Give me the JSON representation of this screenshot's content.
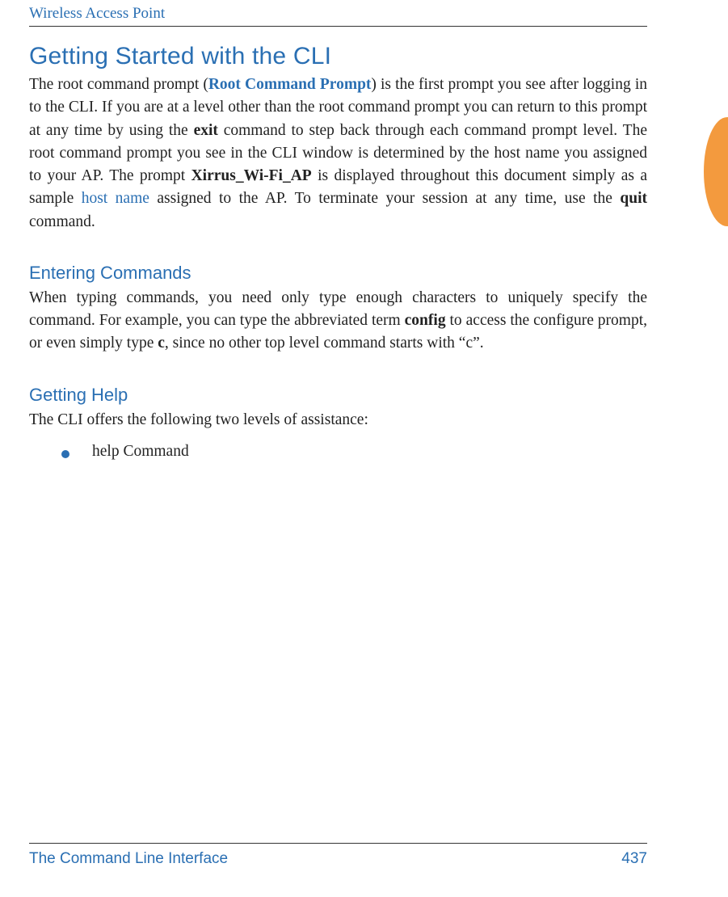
{
  "header": {
    "running_title": "Wireless Access Point"
  },
  "section1": {
    "title": "Getting Started with the CLI",
    "p1_a": "The root command prompt (",
    "p1_link": "Root Command Prompt",
    "p1_b": ") is the first prompt you see after logging in to the CLI. If you are at a level other than the root command prompt you can return to this prompt at any time by using the ",
    "p1_bold1": "exit",
    "p1_c": " command to step back through each command prompt level. The root command prompt you see in the CLI window is determined by the host name you assigned to your AP. The prompt ",
    "p1_bold2": "Xirrus_Wi-Fi_AP",
    "p1_d": " is displayed throughout this document simply as a sample ",
    "p1_link2": "host name",
    "p1_e": " assigned to the AP. To terminate your session at any time, use the ",
    "p1_bold3": "quit",
    "p1_f": " command."
  },
  "section2": {
    "title": "Entering Commands",
    "p1_a": "When typing commands, you need only type enough characters to uniquely specify the command. For example, you can type the abbreviated term ",
    "p1_bold1": "config",
    "p1_b": " to access the configure prompt, or even simply type ",
    "p1_bold2": "c",
    "p1_c": ", since no other top level command starts with “c”."
  },
  "section3": {
    "title": "Getting Help",
    "p1": "The CLI offers the following two levels of assistance:",
    "bullet1": "help Command"
  },
  "footer": {
    "left": "The Command Line Interface",
    "right": "437"
  }
}
